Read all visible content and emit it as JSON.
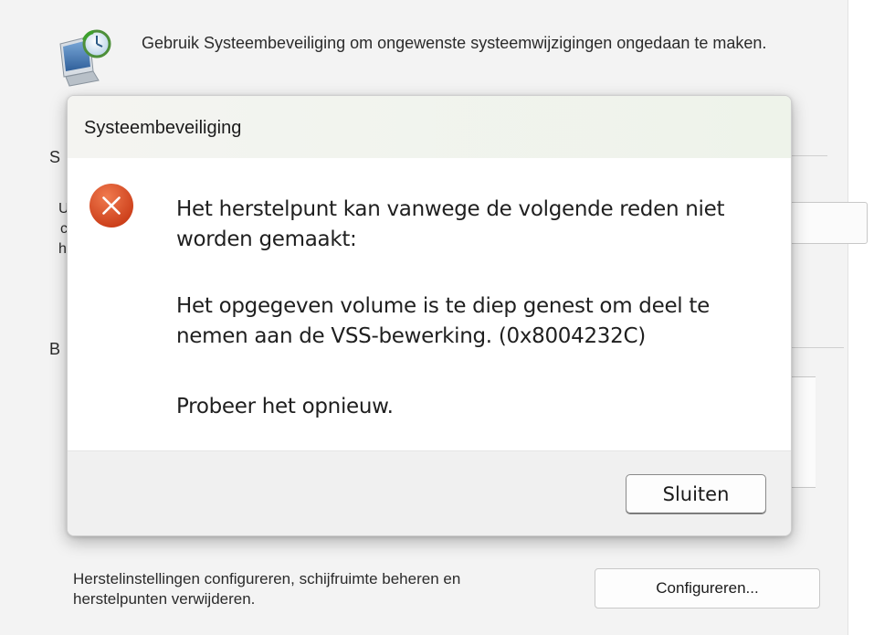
{
  "background": {
    "intro_text": "Gebruik Systeembeveiliging om ongewenste systeemwijzigingen ongedaan te maken.",
    "icon": "system-protection-icon",
    "letters": {
      "s1": "S",
      "u": "U",
      "c": "c",
      "h": "h",
      "b": "B"
    },
    "bottom_text": "Herstelinstellingen configureren, schijfruimte beheren en herstelpunten verwijderen.",
    "configure_label": "Configureren..."
  },
  "dialog": {
    "title": "Systeembeveiliging",
    "icon": "error-icon",
    "icon_color": "#d9441f",
    "message_main": "Het herstelpunt kan vanwege de volgende reden niet worden gemaakt:",
    "message_detail": "Het opgegeven volume is te diep genest om deel te nemen aan de VSS-bewerking. (0x8004232C)",
    "message_retry": "Probeer het opnieuw.",
    "close_label": "Sluiten"
  }
}
